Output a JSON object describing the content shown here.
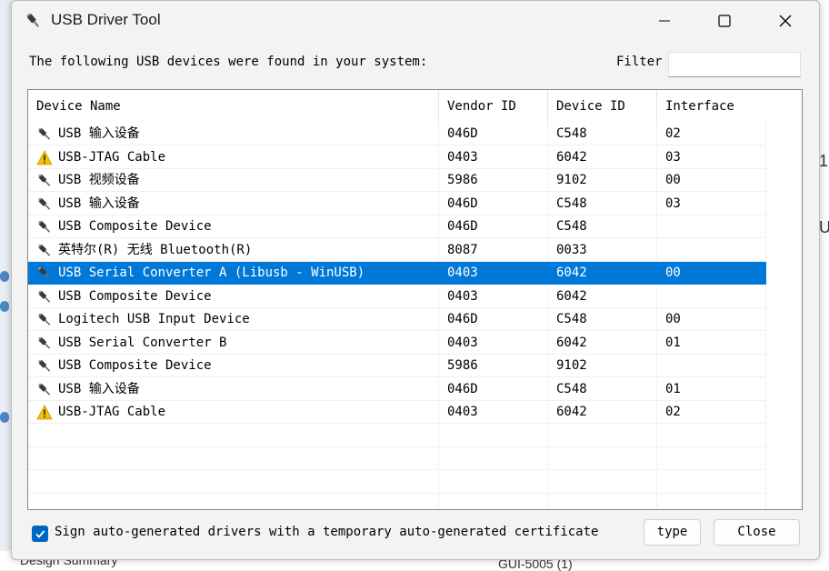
{
  "background": {
    "bottom_left_text": "Design Summary",
    "bottom_right_text": "GUI-5005 (1)",
    "right_glyph_1": "1",
    "right_glyph_2": "U"
  },
  "window": {
    "title": "USB Driver Tool",
    "app_icon": "usb-plug-icon",
    "controls": {
      "minimize": "minimize-icon",
      "maximize": "maximize-icon",
      "close": "close-icon"
    }
  },
  "intro_text": "The following USB devices were found in your system:",
  "filter": {
    "label": "Filter",
    "value": "",
    "placeholder": ""
  },
  "table": {
    "columns": [
      "Device Name",
      "Vendor ID",
      "Device ID",
      "Interface"
    ],
    "selected_index": 6,
    "rows": [
      {
        "icon": "usb-plug-icon",
        "name": "USB 输入设备",
        "vendor": "046D",
        "device": "C548",
        "iface": "02"
      },
      {
        "icon": "warning-icon",
        "name": "USB-JTAG Cable",
        "vendor": "0403",
        "device": "6042",
        "iface": "03"
      },
      {
        "icon": "usb-plug-icon",
        "name": "USB 视频设备",
        "vendor": "5986",
        "device": "9102",
        "iface": "00"
      },
      {
        "icon": "usb-plug-icon",
        "name": "USB 输入设备",
        "vendor": "046D",
        "device": "C548",
        "iface": "03"
      },
      {
        "icon": "usb-plug-icon",
        "name": "USB Composite Device",
        "vendor": "046D",
        "device": "C548",
        "iface": ""
      },
      {
        "icon": "usb-plug-icon",
        "name": "英特尔(R) 无线 Bluetooth(R)",
        "vendor": "8087",
        "device": "0033",
        "iface": ""
      },
      {
        "icon": "usb-plug-icon",
        "name": "USB Serial Converter A (Libusb - WinUSB)",
        "vendor": "0403",
        "device": "6042",
        "iface": "00"
      },
      {
        "icon": "usb-plug-icon",
        "name": "USB Composite Device",
        "vendor": "0403",
        "device": "6042",
        "iface": ""
      },
      {
        "icon": "usb-plug-icon",
        "name": "Logitech USB Input Device",
        "vendor": "046D",
        "device": "C548",
        "iface": "00"
      },
      {
        "icon": "usb-plug-icon",
        "name": "USB Serial Converter B",
        "vendor": "0403",
        "device": "6042",
        "iface": "01"
      },
      {
        "icon": "usb-plug-icon",
        "name": "USB Composite Device",
        "vendor": "5986",
        "device": "9102",
        "iface": ""
      },
      {
        "icon": "usb-plug-icon",
        "name": "USB 输入设备",
        "vendor": "046D",
        "device": "C548",
        "iface": "01"
      },
      {
        "icon": "warning-icon",
        "name": "USB-JTAG Cable",
        "vendor": "0403",
        "device": "6042",
        "iface": "02"
      }
    ]
  },
  "sign_checkbox": {
    "checked": true,
    "label": "Sign auto-generated drivers with a temporary auto-generated certificate"
  },
  "buttons": {
    "type": "type",
    "close": "Close"
  },
  "colors": {
    "selection": "#0078d7",
    "checkbox": "#0067c0",
    "warning": "#f5c000"
  }
}
